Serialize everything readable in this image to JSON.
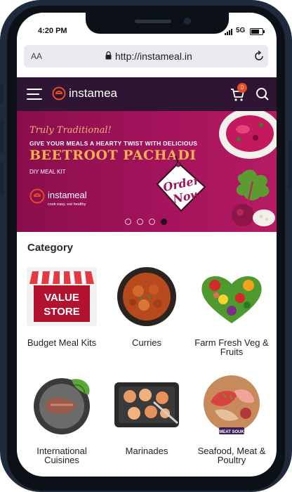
{
  "status": {
    "time": "4:20 PM",
    "network": "5G"
  },
  "browser": {
    "text_size_label": "AA",
    "url": "http://instameal.in"
  },
  "header": {
    "brand": "instamea",
    "cart_count": "0"
  },
  "banner": {
    "tagline": "Truly Traditional!",
    "subtitle": "GIVE YOUR MEALS A HEARTY TWIST WITH DELICIOUS",
    "title": "BEETROOT PACHADI",
    "kit_label": "DIY MEAL KIT",
    "logo_name": "instameal",
    "logo_tagline": "cook easy. eat healthy",
    "cta_line1": "Order",
    "cta_line2": "Now",
    "slides": 4,
    "active_slide": 4
  },
  "category": {
    "title": "Category",
    "items": [
      {
        "label": "Budget Meal Kits",
        "icon": "value-store-icon"
      },
      {
        "label": "Curries",
        "icon": "curry-bowl-icon"
      },
      {
        "label": "Farm Fresh Veg & Fruits",
        "icon": "vegetables-heart-icon"
      },
      {
        "label": "International Cuisines",
        "icon": "international-plate-icon"
      },
      {
        "label": "Marinades",
        "icon": "marinade-tray-icon"
      },
      {
        "label": "Seafood, Meat & Poultry",
        "icon": "meat-platter-icon"
      }
    ],
    "value_store_sign": [
      "VALUE",
      "STORE"
    ],
    "meat_souk_badge": "MEAT SOUK"
  },
  "colors": {
    "header_bg": "#2d1533",
    "banner_bg": "#a3135b",
    "accent_orange": "#e84b23",
    "cta_gold": "#f5b04f"
  }
}
